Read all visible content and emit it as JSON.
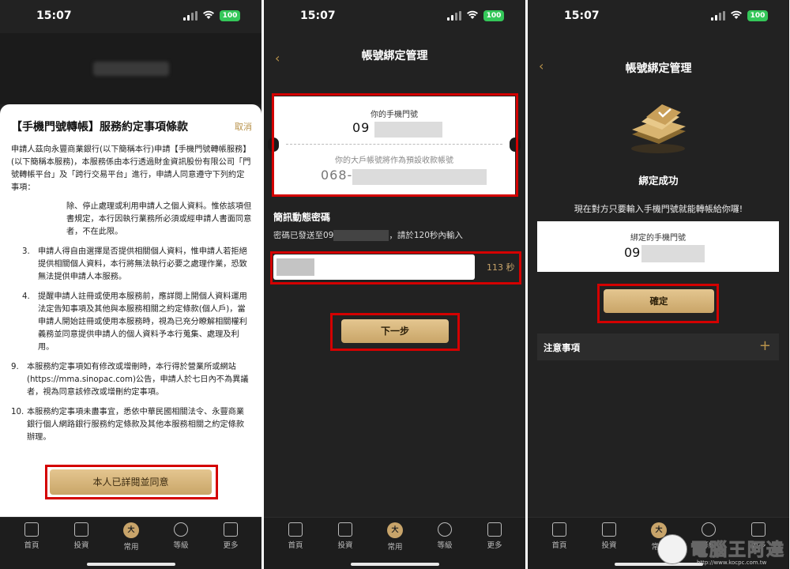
{
  "status": {
    "time": "15:07",
    "battery": "100"
  },
  "screen1": {
    "title": "【手機門號轉帳】服務約定事項條款",
    "cancel": "取消",
    "intro": "申請人茲向永豐商業銀行(以下簡稱本行)申請【手機門號轉帳服務】(以下簡稱本服務)，本服務係由本行透過財金資訊股份有限公司「門號轉帳平台」及「跨行交易平台」進行，申請人同意遵守下列約定事項：",
    "lead_clause": "除、停止處理或利用申請人之個人資料。惟依該項但書規定，本行因執行業務所必須或經申請人書面同意者，不在此限。",
    "clauses": [
      {
        "num": "3.",
        "text": "申請人得自由選擇是否提供相關個人資料，惟申請人若拒絕提供相關個人資料，本行將無法執行必要之處理作業，恐致無法提供申請人本服務。"
      },
      {
        "num": "4.",
        "text": "提醒申請人註冊或使用本服務前，應詳閱上開個人資料運用法定告知事項及其他與本服務相關之約定條款(個人戶)，當申請人開始註冊或使用本服務時，視為已充分瞭解相關權利義務並同意提供申請人的個人資料予本行蒐集、處理及利用。"
      }
    ],
    "clauses_wide": [
      {
        "num": "9.",
        "text": "本服務約定事項如有修改或增刪時，本行得於營業所或網站(https://mma.sinopac.com)公告，申請人於七日內不為異議者，視為同意該修改或增刪約定事項。"
      },
      {
        "num": "10.",
        "text": "本服務約定事項未盡事宜，悉依中華民國相關法令、永豐商業銀行個人網路銀行服務約定條款及其他本服務相關之約定條款辦理。"
      }
    ],
    "agree_button": "本人已詳閱並同意"
  },
  "screen2": {
    "title": "帳號綁定管理",
    "phone_label": "你的手機門號",
    "phone_value": "09",
    "account_label": "你的大戶帳號將作為預設收款帳號",
    "account_value": "068-",
    "otp_title": "簡訊動態密碼",
    "otp_sent_prefix": "密碼已發送至09",
    "otp_sent_suffix": "，請於120秒內輸入",
    "timer": "113 秒",
    "next_button": "下一步"
  },
  "screen3": {
    "title": "帳號綁定管理",
    "success": "綁定成功",
    "desc": "現在對方只要輸入手機門號就能轉帳給你囉!",
    "bound_label": "綁定的手機門號",
    "bound_value": "09",
    "confirm_button": "確定",
    "notes_title": "注意事項"
  },
  "nav": {
    "items": [
      "首頁",
      "投資",
      "常用",
      "等級",
      "更多"
    ],
    "center_glyph": "大"
  },
  "watermark": {
    "text": "電腦王阿達",
    "url": "http://www.kocpc.com.tw"
  },
  "colors": {
    "accent": "#c8a46a",
    "highlight": "#d40000",
    "background": "#222222"
  }
}
